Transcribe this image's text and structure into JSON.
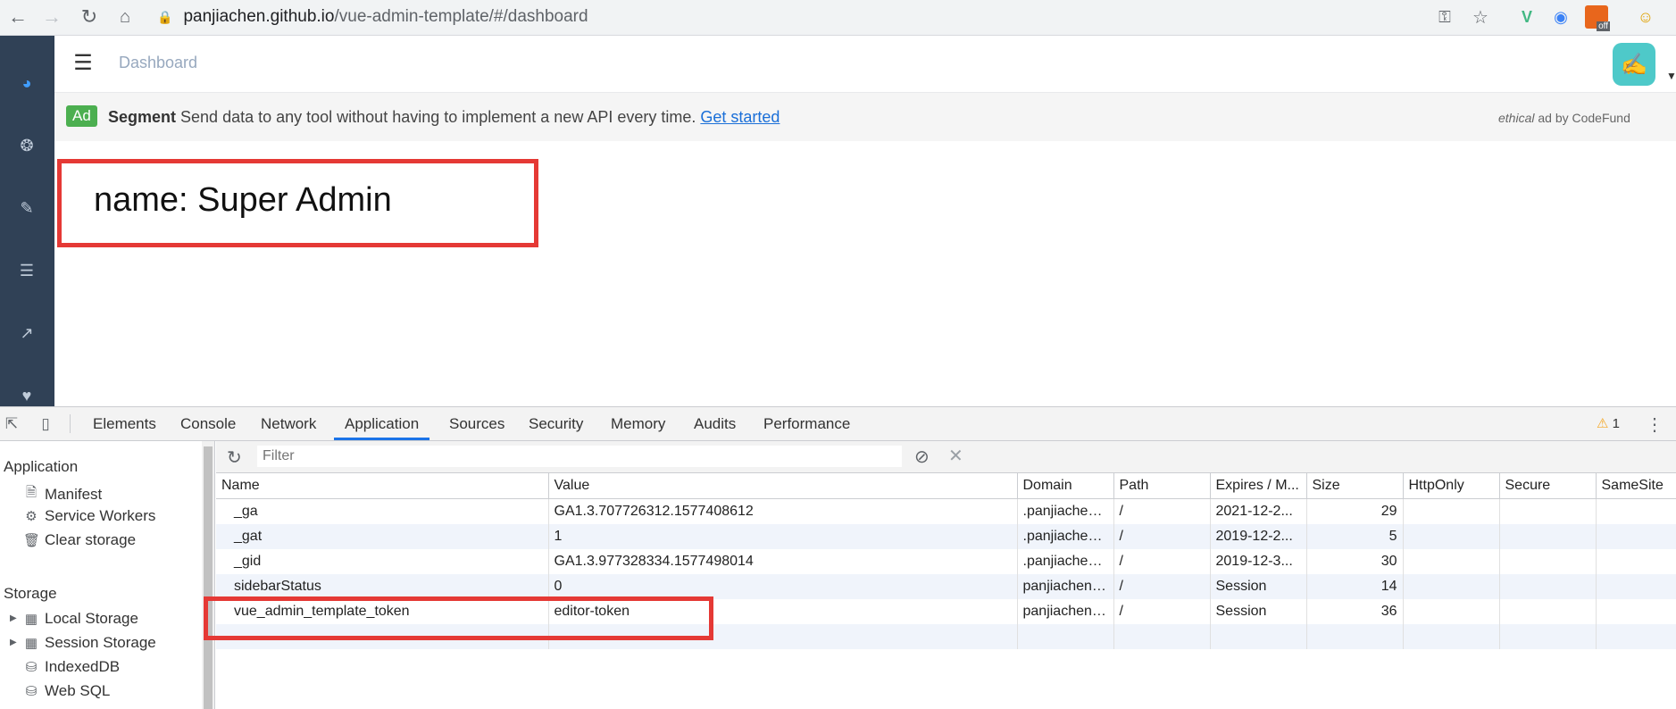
{
  "browser": {
    "url_host": "panjiachen.github.io",
    "url_path": "/vue-admin-template/#/dashboard",
    "ext_off_label": "off"
  },
  "header": {
    "breadcrumb": "Dashboard"
  },
  "ad": {
    "badge": "Ad",
    "brand": "Segment",
    "text": " Send data to any tool without having to implement a new API every time. ",
    "link": "Get started",
    "credit_em": "ethical",
    "credit_rest": " ad by CodeFund"
  },
  "main": {
    "name_line": "name: Super Admin"
  },
  "devtools": {
    "tabs": [
      "Elements",
      "Console",
      "Network",
      "Application",
      "Sources",
      "Security",
      "Memory",
      "Audits",
      "Performance"
    ],
    "active_tab": "Application",
    "warning_count": "1",
    "filter_placeholder": "Filter",
    "sidebar": {
      "application_header": "Application",
      "application_items": [
        "Manifest",
        "Service Workers",
        "Clear storage"
      ],
      "storage_header": "Storage",
      "storage_items": [
        "Local Storage",
        "Session Storage",
        "IndexedDB",
        "Web SQL"
      ]
    },
    "columns": [
      "Name",
      "Value",
      "Domain",
      "Path",
      "Expires / M...",
      "Size",
      "HttpOnly",
      "Secure",
      "SameSite"
    ],
    "rows": [
      {
        "name": "_ga",
        "value": "GA1.3.707726312.1577408612",
        "domain": ".panjiachen...",
        "path": "/",
        "expires": "2021-12-2...",
        "size": "29"
      },
      {
        "name": "_gat",
        "value": "1",
        "domain": ".panjiachen...",
        "path": "/",
        "expires": "2019-12-2...",
        "size": "5"
      },
      {
        "name": "_gid",
        "value": "GA1.3.977328334.1577498014",
        "domain": ".panjiachen...",
        "path": "/",
        "expires": "2019-12-3...",
        "size": "30"
      },
      {
        "name": "sidebarStatus",
        "value": "0",
        "domain": "panjiachen....",
        "path": "/",
        "expires": "Session",
        "size": "14"
      },
      {
        "name": "vue_admin_template_token",
        "value": "editor-token",
        "domain": "panjiachen....",
        "path": "/",
        "expires": "Session",
        "size": "36"
      }
    ]
  },
  "colors": {
    "sidebar_bg": "#304156",
    "highlight_red": "#e53935",
    "active_tab": "#1a73e8",
    "ad_badge": "#4caf50"
  }
}
